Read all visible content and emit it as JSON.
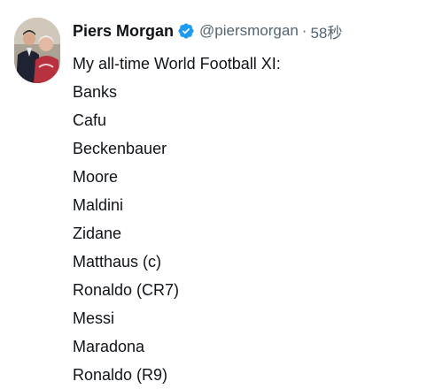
{
  "tweet": {
    "author": {
      "name": "Piers Morgan",
      "handle": "@piersmorgan",
      "verified": true,
      "avatar_icon": "profile-photo-icon"
    },
    "separator": "·",
    "timestamp": "58秒",
    "lines": [
      "My all-time World Football XI:",
      "Banks",
      "Cafu",
      "Beckenbauer",
      "Moore",
      "Maldini",
      "Zidane",
      "Matthaus (c)",
      "Ronaldo (CR7)",
      "Messi",
      "Maradona",
      "Ronaldo (R9)"
    ]
  },
  "colors": {
    "text": "#0f1419",
    "secondary_text": "#536471",
    "verified": "#1d9bf0",
    "background": "#ffffff"
  }
}
